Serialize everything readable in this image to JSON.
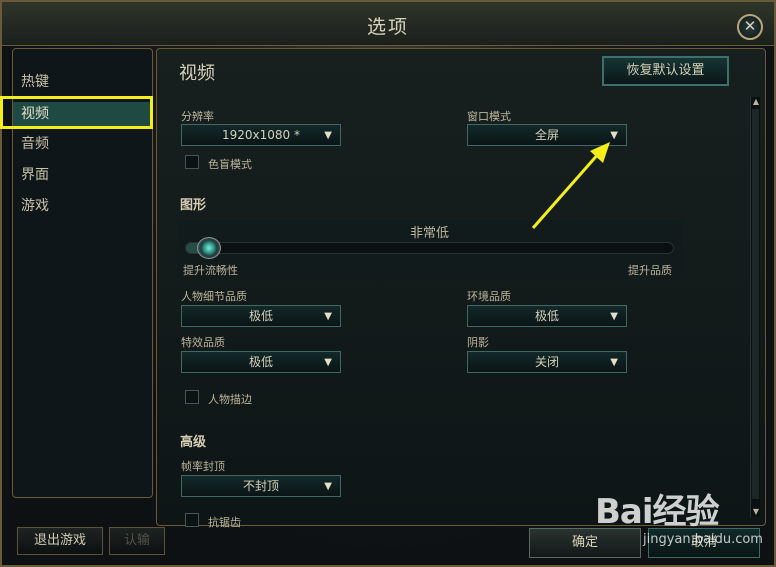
{
  "window": {
    "title": "选项",
    "close_glyph": "✕"
  },
  "sidebar": {
    "items": [
      {
        "label": "热键"
      },
      {
        "label": "视频",
        "active": true
      },
      {
        "label": "音频"
      },
      {
        "label": "界面"
      },
      {
        "label": "游戏"
      }
    ]
  },
  "footer_left": {
    "exit_label": "退出游戏",
    "surrender_label": "认输"
  },
  "panel": {
    "title": "视频",
    "restore_label": "恢复默认设置",
    "resolution": {
      "label": "分辨率",
      "value": "1920x1080 *"
    },
    "window_mode": {
      "label": "窗口模式",
      "value": "全屏"
    },
    "colorblind": {
      "label": "色盲模式",
      "checked": false
    },
    "graphics": {
      "section": "图形",
      "preset_label": "非常低",
      "left_caption": "提升流畅性",
      "right_caption": "提升品质",
      "level": 0.03
    },
    "char_quality": {
      "label": "人物细节品质",
      "value": "极低"
    },
    "env_quality": {
      "label": "环境品质",
      "value": "极低"
    },
    "effects_quality": {
      "label": "特效品质",
      "value": "极低"
    },
    "shadows": {
      "label": "阴影",
      "value": "关闭"
    },
    "char_outline": {
      "label": "人物描边",
      "checked": false
    },
    "advanced": {
      "section": "高级",
      "framerate": {
        "label": "帧率封顶",
        "value": "不封顶"
      },
      "antialias": {
        "label": "抗锯齿",
        "checked": false
      }
    }
  },
  "footer_right": {
    "ok_label": "确定",
    "cancel_label": "取消"
  },
  "icons": {
    "dropdown": "chevron-down-icon",
    "close": "close-icon"
  },
  "colors": {
    "highlight": "#f4ef1b",
    "accent": "#3e6f6a",
    "gold_border": "#6b5a37"
  },
  "watermark": {
    "logo": "Bai经验",
    "site": "jingyan.baidu.com"
  }
}
